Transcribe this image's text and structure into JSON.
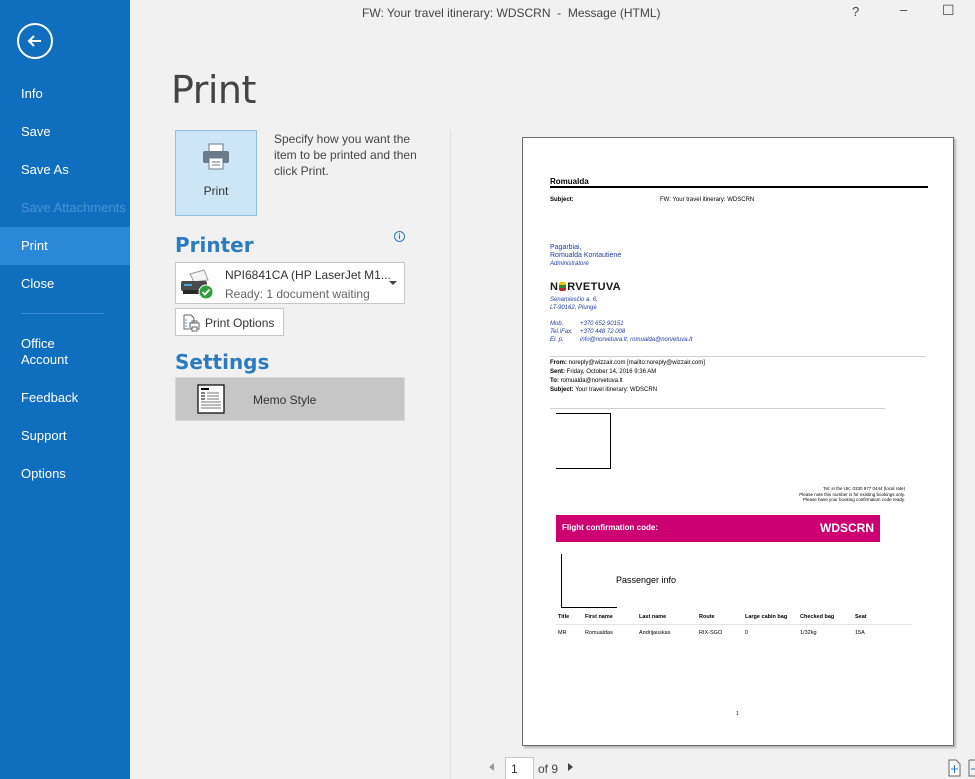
{
  "window": {
    "title": "FW: Your travel itinerary: WDSCRN  -  Message (HTML)",
    "help": "?",
    "minimize": "–",
    "maximize": "☐"
  },
  "sidebar": {
    "back_icon": "back-arrow-icon",
    "items": [
      {
        "label": "Info",
        "state": "normal"
      },
      {
        "label": "Save",
        "state": "normal"
      },
      {
        "label": "Save As",
        "state": "normal"
      },
      {
        "label": "Save Attachments",
        "state": "disabled"
      },
      {
        "label": "Print",
        "state": "active"
      },
      {
        "label": "Close",
        "state": "normal"
      },
      {
        "label": "Office Account",
        "state": "normal"
      },
      {
        "label": "Feedback",
        "state": "normal"
      },
      {
        "label": "Support",
        "state": "normal"
      },
      {
        "label": "Options",
        "state": "normal"
      }
    ],
    "colors": {
      "background": "#106ebe",
      "active": "#2b88d8"
    }
  },
  "print": {
    "title": "Print",
    "button_label": "Print",
    "description": "Specify how you want the item to be printed and then click Print.",
    "printer_heading": "Printer",
    "printer_name": "NPI6841CA (HP LaserJet M1...",
    "printer_status": "Ready: 1 document waiting",
    "print_options_label": "Print Options",
    "settings_heading": "Settings",
    "style_label": "Memo Style"
  },
  "preview": {
    "recipient": "Romualda",
    "subject_label": "Subject:",
    "subject_value": "FW: Your travel itinerary: WDSCRN",
    "signature": {
      "greeting": "Pagarbiai,",
      "name": "Romualda Kontautienė",
      "role": "Administratorė",
      "company": "NORVETUVA",
      "address1": "Senamiesčio a. 6,",
      "address2": "LT-90162, Plungė",
      "mob_label": "Mob.",
      "mob_value": "+370 652 90151",
      "tel_label": "Tel.\\Fax.",
      "tel_value": "+370 448 72 008",
      "email_label": "El. p.",
      "email_value": "info@norvetuva.lt; romualda@norvetuva.lt"
    },
    "forwarded": {
      "from_label": "From:",
      "from_value": "noreply@wizzair.com [mailto:noreply@wizzair.com]",
      "sent_label": "Sent:",
      "sent_value": "Friday, October 14, 2016 9:36 AM",
      "to_label": "To:",
      "to_value": "romualda@norvetuva.lt",
      "subject_label": "Subject:",
      "subject_value": "Your travel itinerary: WDSCRN"
    },
    "tel_info": [
      "Tel: in the UK: 0330 977 0444 (local rate)",
      "Please note this number is for existing bookings only.",
      "Please have your booking confirmation code ready."
    ],
    "confirmation_label": "Flight confirmation code:",
    "confirmation_code": "WDSCRN",
    "confirmation_color": "#cc0071",
    "passenger_info_label": "Passenger info",
    "table": {
      "headers": [
        "Title",
        "First name",
        "Last name",
        "Route",
        "Large cabin bag",
        "Checked bag",
        "Seat"
      ],
      "rows": [
        [
          "MR",
          "Romualdas",
          "Andrijauskas",
          "RIX-SGO",
          "0",
          "1/32kg",
          "15A"
        ]
      ]
    },
    "page_number": "1"
  },
  "pager": {
    "current_page": "1",
    "of_label": "of 9"
  }
}
